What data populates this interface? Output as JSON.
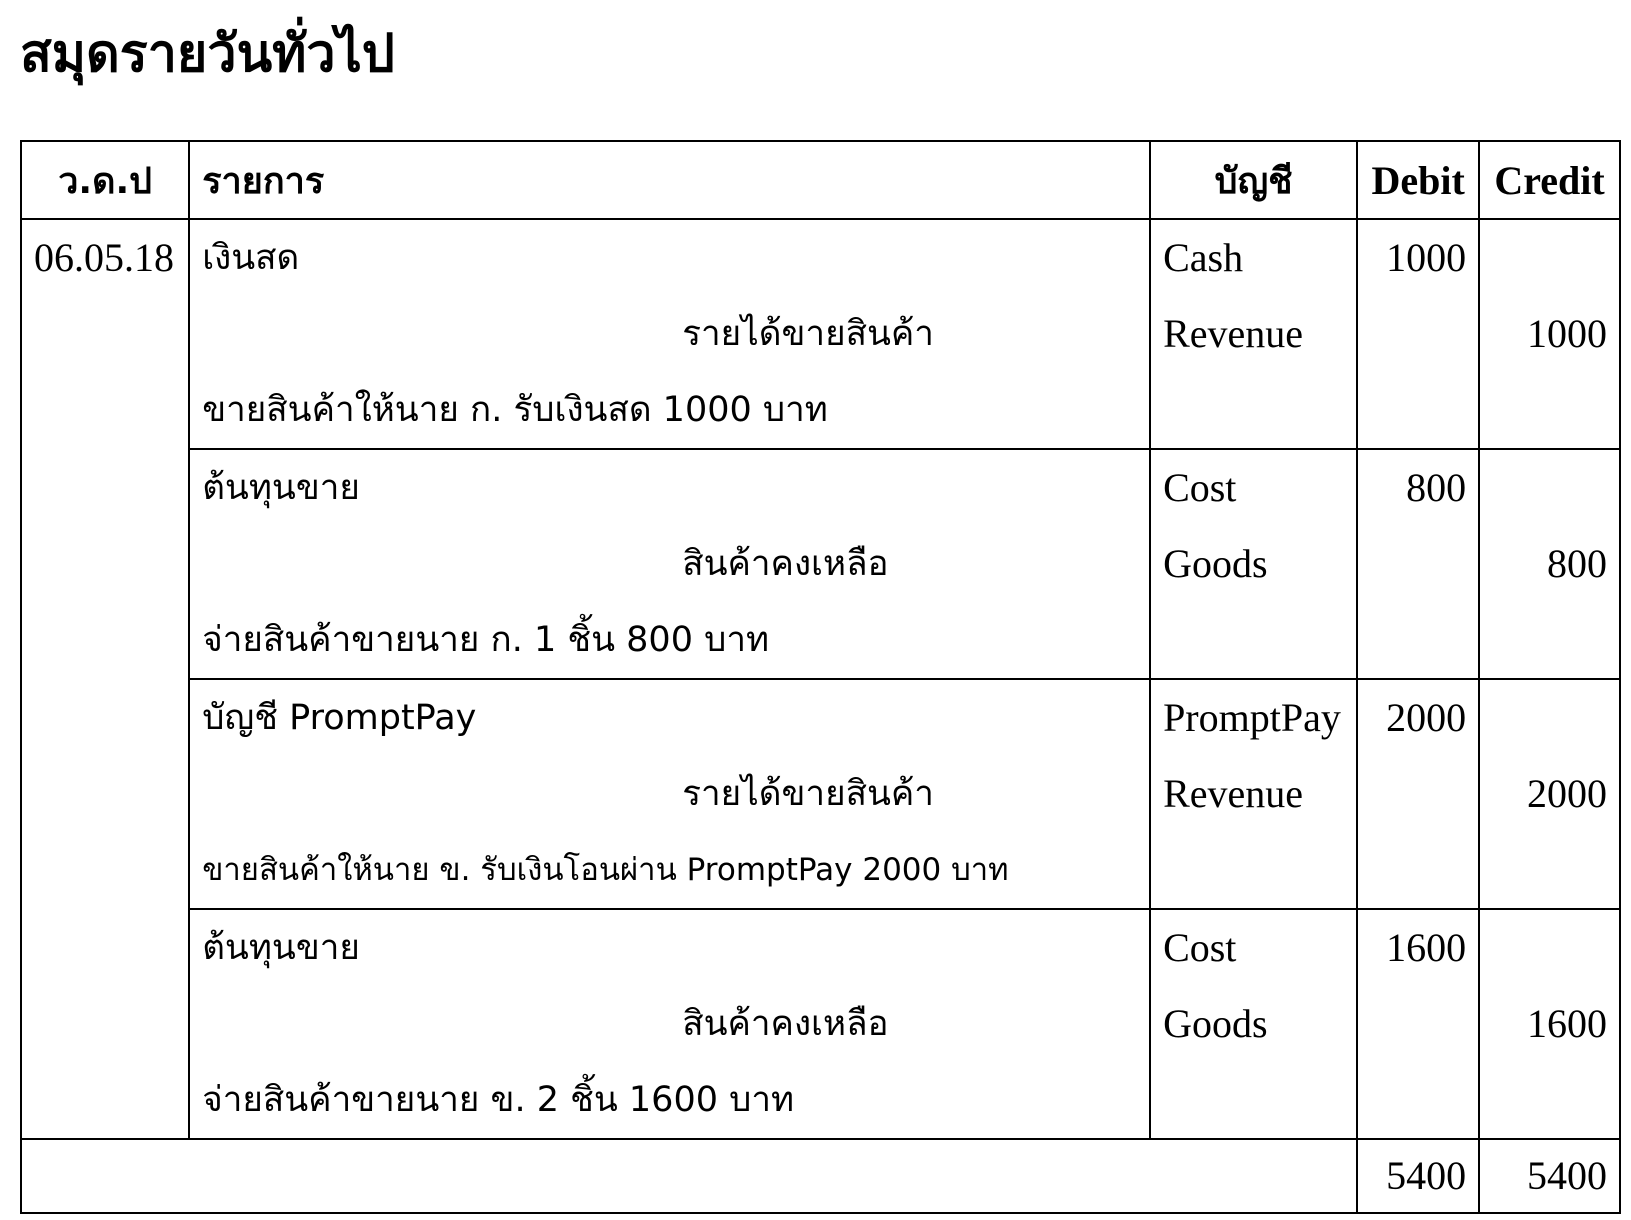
{
  "title": "สมุดรายวันทั่วไป",
  "table": {
    "headers": {
      "date": "ว.ด.ป",
      "description": "รายการ",
      "account": "บัญชี",
      "debit": "Debit",
      "credit": "Credit"
    },
    "date": "06.05.18",
    "entries": [
      {
        "debit_desc": "เงินสด",
        "credit_desc": "รายได้ขายสินค้า",
        "memo": "ขายสินค้าให้นาย ก. รับเงินสด 1000 บาท",
        "debit_account": "Cash",
        "credit_account": "Revenue",
        "debit_amount": "1000",
        "credit_amount": "1000"
      },
      {
        "debit_desc": "ต้นทุนขาย",
        "credit_desc": "สินค้าคงเหลือ",
        "memo": "จ่ายสินค้าขายนาย ก. 1 ชิ้น 800 บาท",
        "debit_account": "Cost",
        "credit_account": "Goods",
        "debit_amount": "800",
        "credit_amount": "800"
      },
      {
        "debit_desc": "บัญชี PromptPay",
        "credit_desc": "รายได้ขายสินค้า",
        "memo": "ขายสินค้าให้นาย ข. รับเงินโอนผ่าน PromptPay 2000 บาท",
        "debit_account": "PromptPay",
        "credit_account": "Revenue",
        "debit_amount": "2000",
        "credit_amount": "2000"
      },
      {
        "debit_desc": "ต้นทุนขาย",
        "credit_desc": "สินค้าคงเหลือ",
        "memo": "จ่ายสินค้าขายนาย ข. 2 ชิ้น 1600 บาท",
        "debit_account": "Cost",
        "credit_account": "Goods",
        "debit_amount": "1600",
        "credit_amount": "1600"
      }
    ],
    "totals": {
      "debit": "5400",
      "credit": "5400"
    }
  }
}
